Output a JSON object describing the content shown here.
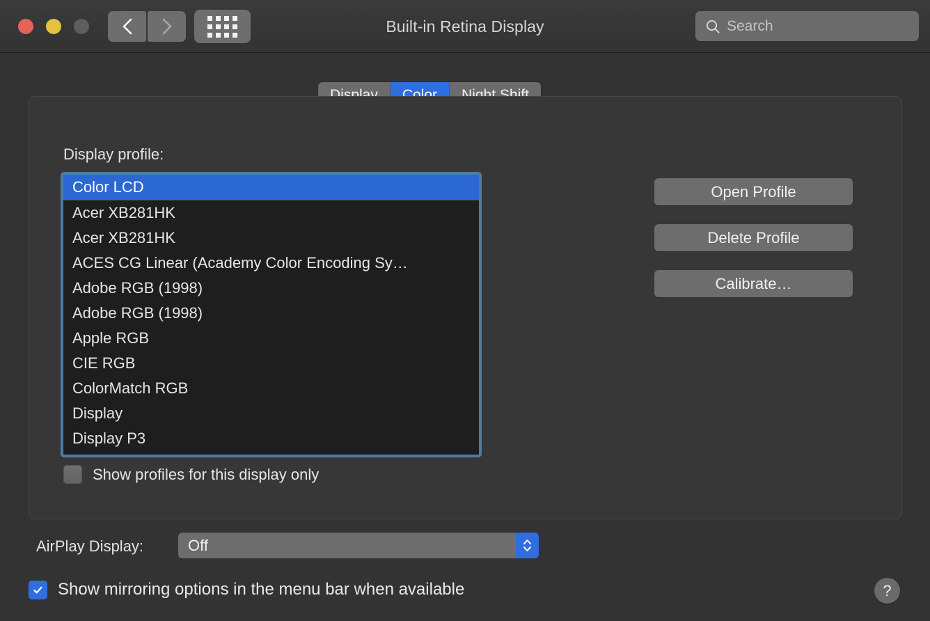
{
  "window": {
    "title": "Built-in Retina Display",
    "traffic_lights": [
      {
        "name": "close",
        "color": "#e8605a"
      },
      {
        "name": "minimize",
        "color": "#e5c140"
      },
      {
        "name": "zoom",
        "color": "#5e5e5e"
      }
    ]
  },
  "toolbar": {
    "back_icon": "chevron-left-icon",
    "forward_icon": "chevron-right-icon",
    "grid_icon": "show-all-grid-icon",
    "search": {
      "icon": "search-icon",
      "value": "",
      "placeholder": "Search"
    }
  },
  "tabs": [
    {
      "label": "Display",
      "active": false
    },
    {
      "label": "Color",
      "active": true
    },
    {
      "label": "Night Shift",
      "active": false
    }
  ],
  "panel": {
    "profile_label": "Display profile:",
    "profiles": [
      {
        "label": "Color LCD",
        "selected": true
      },
      {
        "label": "Acer XB281HK",
        "selected": false
      },
      {
        "label": "Acer XB281HK",
        "selected": false
      },
      {
        "label": "ACES CG Linear (Academy Color Encoding Sy…",
        "selected": false
      },
      {
        "label": "Adobe RGB (1998)",
        "selected": false
      },
      {
        "label": "Adobe RGB (1998)",
        "selected": false
      },
      {
        "label": "Apple RGB",
        "selected": false
      },
      {
        "label": "CIE RGB",
        "selected": false
      },
      {
        "label": "ColorMatch RGB",
        "selected": false
      },
      {
        "label": "Display",
        "selected": false
      },
      {
        "label": "Display P3",
        "selected": false
      }
    ],
    "buttons": [
      {
        "label": "Open Profile"
      },
      {
        "label": "Delete Profile"
      },
      {
        "label": "Calibrate…"
      }
    ],
    "show_profiles_only": {
      "label": "Show profiles for this display only",
      "checked": false
    }
  },
  "airplay": {
    "label": "AirPlay Display:",
    "value": "Off",
    "stepper_icon": "chevron-up-down-icon"
  },
  "mirroring": {
    "label": "Show mirroring options in the menu bar when available",
    "checked": true
  },
  "help": {
    "label": "?",
    "icon": "help-icon"
  },
  "colors": {
    "accent": "#2f6ee0",
    "window_bg": "#333333",
    "panel_bg": "#373737",
    "list_bg": "#1e1e1e",
    "focus_ring": "#4e7ba6"
  }
}
